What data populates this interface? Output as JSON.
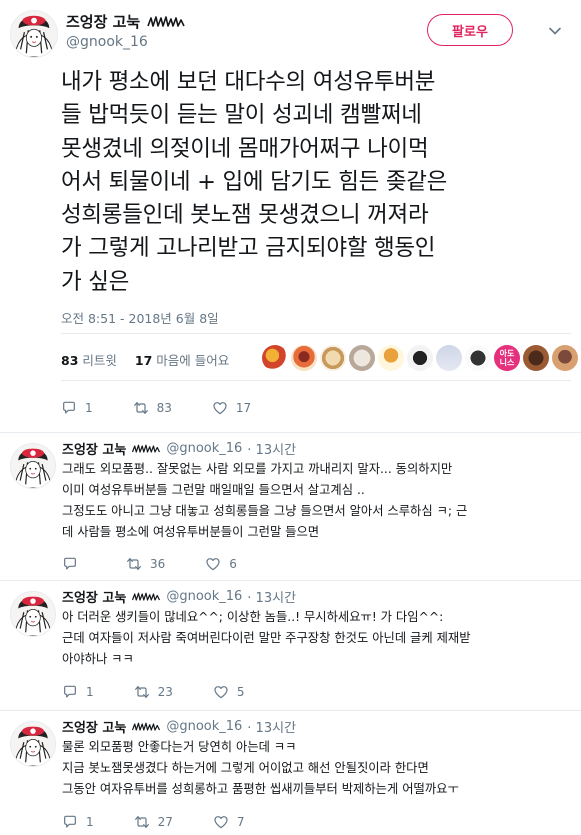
{
  "main_tweet": {
    "author_name": "즈엉장 고눅",
    "handle": "@gnook_16",
    "follow_label": "팔로우",
    "text_lines": [
      "내가 평소에 보던 대다수의 여성유투버분",
      "들 밥먹듯이 듣는 말이 성괴네 캠빨쩌네",
      "못생겼네 의젖이네 몸매가어쩌구 나이먹",
      "어서 퇴물이네 + 입에 담기도 힘든 좆같은",
      "성희롱들인데 봇노잼 못생겼으니 꺼져라",
      "가 그렇게 고나리받고 금지되야할 행동인",
      "가 싶은"
    ],
    "timestamp": "오전 8:51 - 2018년 6월 8일",
    "retweet_count": "83",
    "retweet_label": "리트윗",
    "like_count": "17",
    "like_label": "마음에 들어요",
    "liker_avatar_text": [
      "아도",
      "니스"
    ],
    "actions": {
      "replies": "1",
      "retweets": "83",
      "likes": "17"
    }
  },
  "replies": [
    {
      "author_name": "즈엉장 고눅",
      "handle": "@gnook_16",
      "time": "· 13시간",
      "text_lines": [
        "그래도 외모품평.. 잘못없는 사람 외모를 가지고 까내리지 말자... 동의하지만",
        "이미 여성유투버분들 그런말 매일매일 들으면서 살고계심 ..",
        "그정도도 아니고 그냥 대놓고 성희롱들을 그냥 들으면서 알아서 스루하심 ㅋ; 근",
        "데 사람들 평소에 여성유투버분들이 그런말 들으면"
      ],
      "actions": {
        "replies": "",
        "retweets": "36",
        "likes": "6"
      }
    },
    {
      "author_name": "즈엉장 고눅",
      "handle": "@gnook_16",
      "time": "· 13시간",
      "text_lines": [
        "아 더러운 생키들이 많네요^^; 이상한 놈들..! 무시하세요ㅠ! 가 다임^^:",
        "근데 여자들이 저사람 죽여버린다이런 말만 주구장창 한것도 아닌데 글케 제재받",
        "아야하나 ㅋㅋ"
      ],
      "actions": {
        "replies": "1",
        "retweets": "23",
        "likes": "5"
      }
    },
    {
      "author_name": "즈엉장 고눅",
      "handle": "@gnook_16",
      "time": "· 13시간",
      "text_lines": [
        "물론 외모품평 안좋다는거 당연히 아는데 ㅋㅋ",
        "지금 봇노잼못생겼다 하는거에 그렇게 어이없고 해선 안될짓이라 한다면",
        "그동안 여자유투버를 성희롱하고 품평한 씹새끼들부터 박제하는게 어떨까요ㅜ"
      ],
      "actions": {
        "replies": "1",
        "retweets": "27",
        "likes": "7"
      }
    }
  ],
  "colors": {
    "follow_accent": "#e0245e",
    "muted_text": "#657786",
    "primary_text": "#14171a",
    "divider": "#e6ecf0"
  },
  "icons": [
    "reply-icon",
    "retweet-icon",
    "heart-icon",
    "chevron-down-icon",
    "scribble-emoji-icon"
  ]
}
